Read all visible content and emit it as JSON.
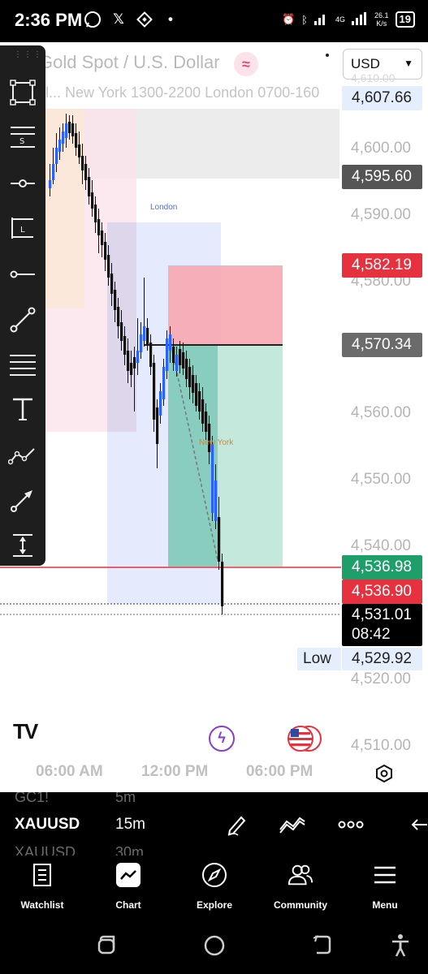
{
  "status_bar": {
    "time": "2:36 PM",
    "network_speed_value": "26.1",
    "network_speed_unit": "K/s",
    "network_type": "4G",
    "battery": "19"
  },
  "chart_header": {
    "title": "Gold Spot / U.S. Dollar",
    "sessions_text": "l... New York 1300-2200 London 0700-160",
    "currency": "USD"
  },
  "price_axis": {
    "labels": [
      "4,600.00",
      "4,590.00",
      "4,580.00",
      "4,560.00",
      "4,550.00",
      "4,540.00",
      "4,520.00",
      "4,510.00"
    ],
    "partial_label": "4,610.00"
  },
  "price_tags": {
    "top": "4,607.66",
    "upper_level": "4,595.60",
    "stop_level": "4,582.19",
    "entry_level": "4,570.34",
    "bid": "4,536.98",
    "ask": "4,536.90",
    "last": "4,531.01",
    "countdown": "08:42",
    "low_label": "Low",
    "low_value": "4,529.92"
  },
  "session_labels": {
    "london": "London",
    "new_york": "New York"
  },
  "time_axis": [
    "06:00 AM",
    "12:00 PM",
    "06:00 PM"
  ],
  "branding": {
    "logo": "TV"
  },
  "toolbar_tools": [
    "rectangle-tool",
    "fib-settings-tool",
    "horizontal-ray-tool",
    "long-position-tool",
    "horizontal-line-tool",
    "trend-line-tool",
    "parallel-lines-tool",
    "text-tool",
    "path-tool",
    "arrow-tool",
    "measure-tool"
  ],
  "symbol_bar": {
    "prev_symbol": "GC1!",
    "prev_interval": "5m",
    "symbol": "XAUUSD",
    "interval": "15m",
    "next_symbol": "XAUUSD",
    "next_interval": "30m"
  },
  "bottom_nav": [
    {
      "label": "Watchlist",
      "icon": "watchlist-icon"
    },
    {
      "label": "Chart",
      "icon": "chart-icon"
    },
    {
      "label": "Explore",
      "icon": "compass-icon"
    },
    {
      "label": "Community",
      "icon": "community-icon"
    },
    {
      "label": "Menu",
      "icon": "menu-icon"
    }
  ],
  "colors": {
    "bullish": "#2962ff",
    "bearish": "#000000",
    "stop_zone": "#f7a8b0",
    "target_zone": "#bfe6d9",
    "tag_red": "#e5323e",
    "tag_green": "#1e9f6a"
  }
}
